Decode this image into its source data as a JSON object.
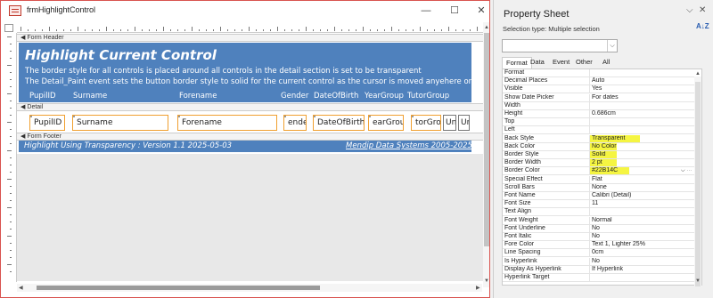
{
  "window": {
    "title": "frmHighlightControl",
    "minimize": "—",
    "maximize": "☐",
    "close": "✕"
  },
  "sections": {
    "header": "Form Header",
    "detail": "Detail",
    "footer": "Form Footer"
  },
  "form_header": {
    "title": "Highlight Current Control",
    "line1": "The border style for all controls is placed around all controls in the detail section is set to be transparent",
    "line2": "The Detail_Paint event sets the button border style to solid for the current control as the cursor is moved anyehere on the form",
    "columns": [
      "PupilID",
      "Surname",
      "Forename",
      "Gender",
      "DateOfBirth",
      "YearGroup",
      "TutorGroup"
    ]
  },
  "detail_fields": [
    "PupilID",
    "Surname",
    "Forename",
    "ende",
    "DateOfBirth",
    "earGrou",
    "torGro"
  ],
  "detail_buttons": [
    "Un",
    "Ur"
  ],
  "form_footer": {
    "left": "Highlight Using Transparency :  Version 1.1   2025-05-03",
    "right": "Mendip Data Systems 2005-2025"
  },
  "property_sheet": {
    "title": "Property Sheet",
    "chevron": "⌵",
    "close": "✕",
    "selection_label": "Selection type:",
    "selection_value": "Multiple selection",
    "sort_icon": "A↓Z",
    "combo_value": "",
    "tabs": [
      "Format",
      "Data",
      "Event",
      "Other",
      "All"
    ],
    "active_tab": "Format",
    "highlight_color": "#f5f542",
    "rows": [
      {
        "name": "Format",
        "value": ""
      },
      {
        "name": "Decimal Places",
        "value": "Auto"
      },
      {
        "name": "Visible",
        "value": "Yes"
      },
      {
        "name": "Show Date Picker",
        "value": "For dates"
      },
      {
        "name": "Width",
        "value": ""
      },
      {
        "name": "Height",
        "value": "0.686cm"
      },
      {
        "name": "Top",
        "value": ""
      },
      {
        "name": "Left",
        "value": ""
      },
      {
        "name": "Back Style",
        "value": "Transparent"
      },
      {
        "name": "Back Color",
        "value": "No Color"
      },
      {
        "name": "Border Style",
        "value": "Solid"
      },
      {
        "name": "Border Width",
        "value": "2 pt"
      },
      {
        "name": "Border Color",
        "value": "#22B14C"
      },
      {
        "name": "Special Effect",
        "value": "Flat"
      },
      {
        "name": "Scroll Bars",
        "value": "None"
      },
      {
        "name": "Font Name",
        "value": "Calibri (Detail)"
      },
      {
        "name": "Font Size",
        "value": "11"
      },
      {
        "name": "Text Align",
        "value": ""
      },
      {
        "name": "Font Weight",
        "value": "Normal"
      },
      {
        "name": "Font Underline",
        "value": "No"
      },
      {
        "name": "Font Italic",
        "value": "No"
      },
      {
        "name": "Fore Color",
        "value": "Text 1, Lighter 25%"
      },
      {
        "name": "Line Spacing",
        "value": "0cm"
      },
      {
        "name": "Is Hyperlink",
        "value": "No"
      },
      {
        "name": "Display As Hyperlink",
        "value": "If Hyperlink"
      },
      {
        "name": "Hyperlink Target",
        "value": ""
      }
    ]
  }
}
